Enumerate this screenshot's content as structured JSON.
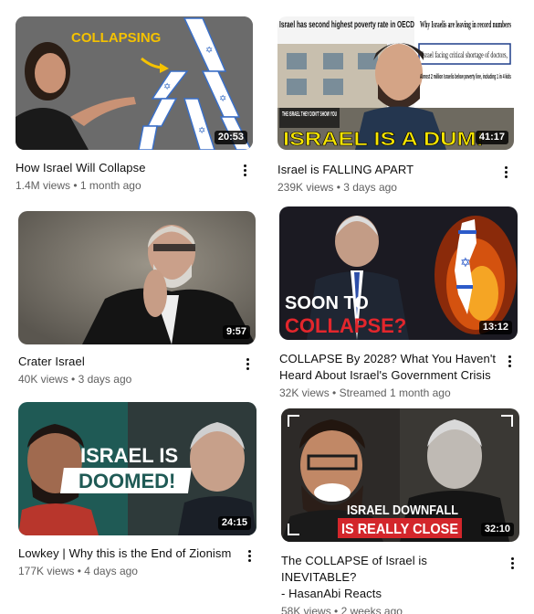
{
  "videos": [
    {
      "title": "How Israel Will Collapse",
      "views": "1.4M views",
      "age": "1 month ago",
      "duration": "20:53",
      "thumb_text": [
        "COLLAPSING"
      ]
    },
    {
      "title": "Israel is FALLING APART",
      "views": "239K views",
      "age": "3 days ago",
      "duration": "41:17",
      "thumb_text": [
        "Israel has second highest poverty rate in OECD",
        "Why Israelis are leaving in record numbers",
        "Israel facing critical shortage of doctors,",
        "Almost 2 million Israelis below poverty line, including 1 in 4 kids",
        "THE ISRAEL THEY DON'T SHOW YOU",
        "ISRAEL IS A DUM!"
      ]
    },
    {
      "title": "Crater Israel",
      "views": "40K views",
      "age": "3 days ago",
      "duration": "9:57",
      "thumb_text": []
    },
    {
      "title": "COLLAPSE By 2028? What You Haven't Heard About Israel's Government Crisis",
      "title_lines": [
        "COLLAPSE By 2028? What You Haven't",
        "Heard About Israel's Government Crisis"
      ],
      "views": "32K views",
      "age": "Streamed 1 month ago",
      "duration": "13:12",
      "thumb_text": [
        "SOON TO",
        "COLLAPSE?"
      ]
    },
    {
      "title": "Lowkey | Why this is the End of Zionism",
      "views": "177K views",
      "age": "4 days ago",
      "duration": "24:15",
      "thumb_text": [
        "ISRAEL IS",
        "DOOMED!"
      ]
    },
    {
      "title": "The COLLAPSE of Israel is INEVITABLE? - HasanAbi Reacts",
      "title_lines": [
        "The COLLAPSE of Israel is INEVITABLE?",
        "- HasanAbi Reacts"
      ],
      "views": "58K views",
      "age": "2 weeks ago",
      "duration": "32:10",
      "thumb_text": [
        "ISRAEL DOWNFALL",
        "IS REALLY CLOSE"
      ]
    }
  ],
  "separator": " • ",
  "icons": {
    "more": "more-vertical-icon"
  },
  "colors": {
    "meta_text": "#606060",
    "title_text": "#0f0f0f",
    "duration_bg": "#000000"
  }
}
